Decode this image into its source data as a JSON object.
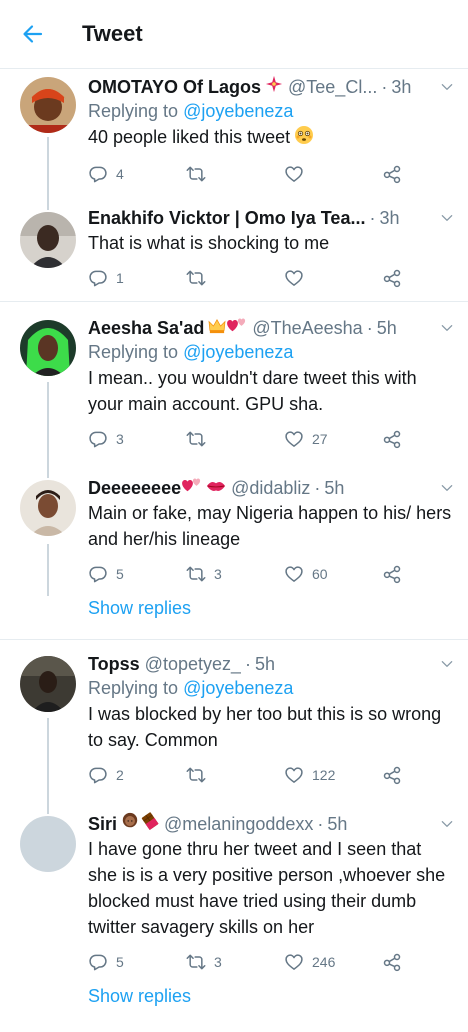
{
  "header": {
    "title": "Tweet"
  },
  "tweets": [
    {
      "name": "OMOTAYO Of Lagos",
      "handle": "@Tee_Cl...",
      "time": "3h",
      "replying_label": "Replying to",
      "replying_to": "@joyebeneza",
      "text": "40 people liked this tweet",
      "replies": "4",
      "retweets": "",
      "likes": ""
    },
    {
      "name": "Enakhifo Vicktor | Omo Iya Tea...",
      "handle": "",
      "time": "3h",
      "text": "That is what is shocking to me",
      "replies": "1",
      "retweets": "",
      "likes": ""
    },
    {
      "name": "Aeesha Sa'ad",
      "handle": "@TheAeesha",
      "time": "5h",
      "replying_label": "Replying to",
      "replying_to": "@joyebeneza",
      "text": "I mean.. you wouldn't dare tweet this with your main account. GPU sha.",
      "replies": "3",
      "retweets": "",
      "likes": "27"
    },
    {
      "name": "Deeeeeeee",
      "handle": "@didabliz",
      "time": "5h",
      "text": "Main or fake, may Nigeria happen to his/ hers and her/his lineage",
      "replies": "5",
      "retweets": "3",
      "likes": "60",
      "show_replies": "Show replies"
    },
    {
      "name": "Topss",
      "handle": "@topetyez_",
      "time": "5h",
      "replying_label": "Replying to",
      "replying_to": "@joyebeneza",
      "text": "I was blocked by her too but this is so wrong to say. Common",
      "replies": "2",
      "retweets": "",
      "likes": "122"
    },
    {
      "name": "Siri",
      "handle": "@melaningoddexx",
      "time": "5h",
      "text": "I have gone thru her tweet and I seen that she is is a very positive person ,whoever she blocked must have tried using their dumb twitter savagery skills on her",
      "replies": "5",
      "retweets": "3",
      "likes": "246",
      "show_replies": "Show replies"
    }
  ],
  "colors": {
    "accent": "#1da1f2",
    "secondary_text": "#657786",
    "divider": "#e6ecf0"
  }
}
